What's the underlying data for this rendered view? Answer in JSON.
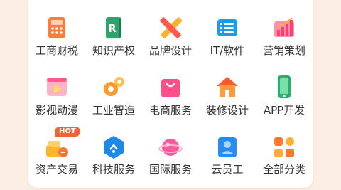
{
  "services": [
    {
      "label": "工商财税",
      "icon": "calculator-icon"
    },
    {
      "label": "知识产权",
      "icon": "book-r-icon"
    },
    {
      "label": "品牌设计",
      "icon": "pencil-ruler-icon"
    },
    {
      "label": "IT/软件",
      "icon": "server-list-icon"
    },
    {
      "label": "营销策划",
      "icon": "bar-chart-icon"
    },
    {
      "label": "影视动漫",
      "icon": "video-play-icon"
    },
    {
      "label": "工业智造",
      "icon": "gears-icon"
    },
    {
      "label": "电商服务",
      "icon": "shopping-bag-icon"
    },
    {
      "label": "装修设计",
      "icon": "house-icon"
    },
    {
      "label": "APP开发",
      "icon": "smartphone-icon"
    },
    {
      "label": "资产交易",
      "icon": "gold-coins-icon",
      "badge": "HOT"
    },
    {
      "label": "科技服务",
      "icon": "hexagon-link-icon"
    },
    {
      "label": "国际服务",
      "icon": "planet-icon"
    },
    {
      "label": "云员工",
      "icon": "id-card-icon"
    },
    {
      "label": "全部分类",
      "icon": "grid-squares-icon"
    }
  ]
}
